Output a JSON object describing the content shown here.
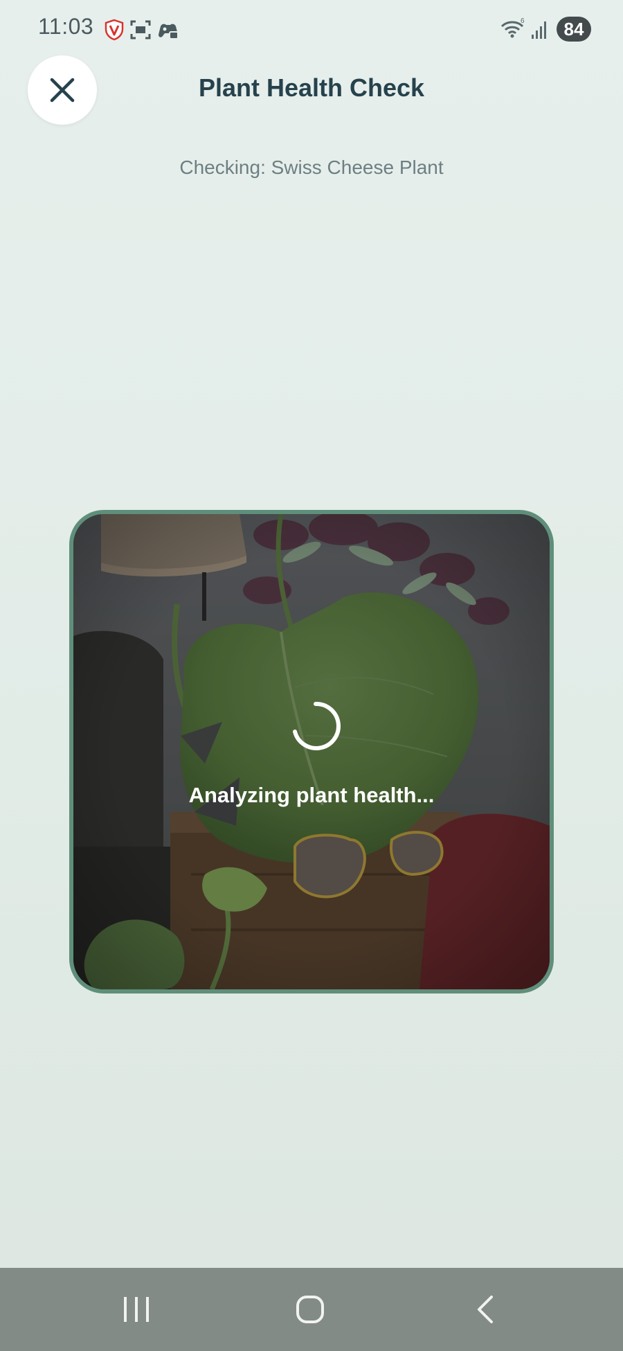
{
  "status_bar": {
    "time": "11:03",
    "battery": "84",
    "icons": [
      "vpn-shield-icon",
      "screenshot-icon",
      "game-controller-icon",
      "wifi-icon",
      "signal-icon"
    ]
  },
  "header": {
    "title": "Plant Health Check",
    "close_icon": "close-icon"
  },
  "subtitle": "Checking: Swiss Cheese Plant",
  "analysis": {
    "status_text": "Analyzing plant health...",
    "spinner_icon": "loading-spinner-icon"
  },
  "nav_bar": {
    "buttons": [
      "recents-icon",
      "home-icon",
      "back-icon"
    ]
  },
  "colors": {
    "background": "#e4ede9",
    "frame_border": "#5f8f7b",
    "title": "#26424c",
    "subtitle": "#6c7f82",
    "nav_bar": "#838b86"
  }
}
